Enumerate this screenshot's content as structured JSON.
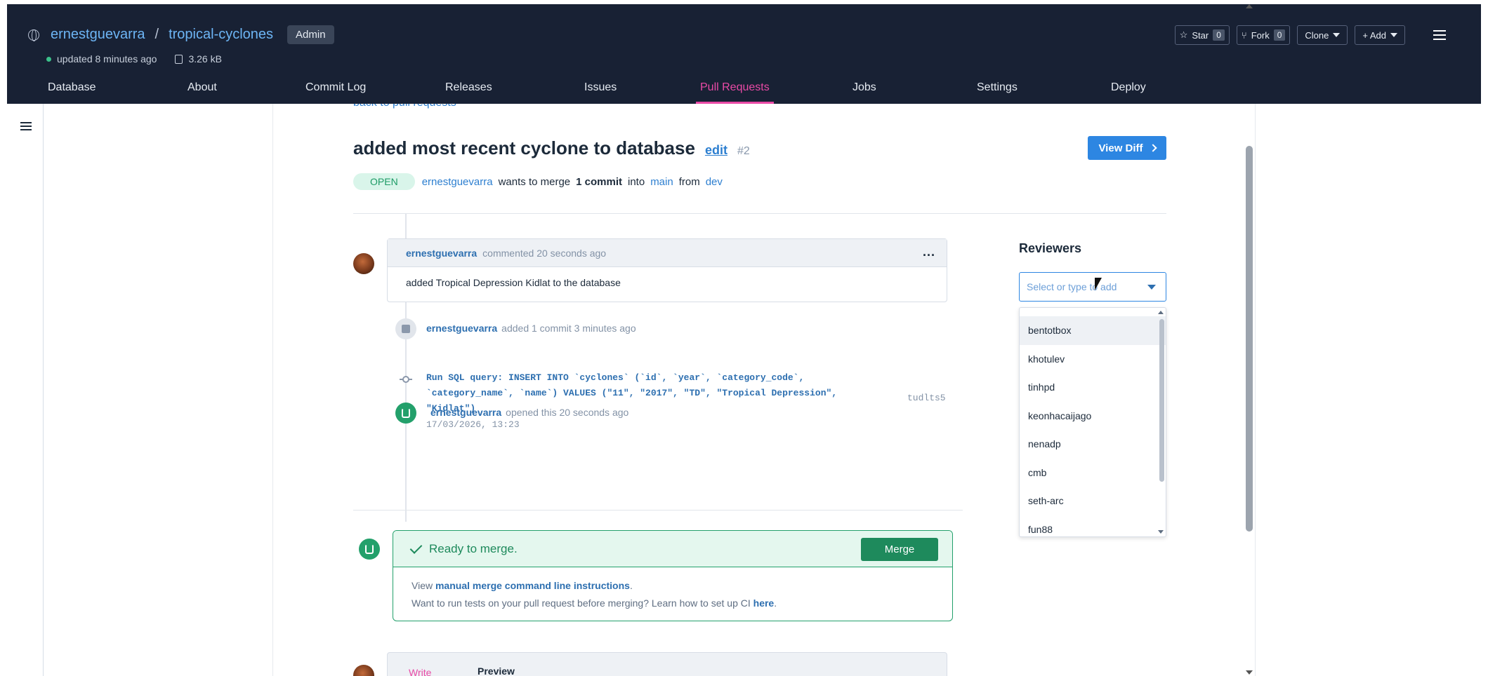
{
  "header": {
    "owner": "ernestguevarra",
    "separator": "/",
    "repo": "tropical-cyclones",
    "role_badge": "Admin",
    "updated": "updated 8 minutes ago",
    "size": "3.26 kB",
    "star_label": "Star",
    "star_count": "0",
    "fork_label": "Fork",
    "fork_count": "0",
    "clone_label": "Clone",
    "add_label": "+ Add"
  },
  "tabs": [
    "Database",
    "About",
    "Commit Log",
    "Releases",
    "Issues",
    "Pull Requests",
    "Jobs",
    "Settings",
    "Deploy"
  ],
  "active_tab": "Pull Requests",
  "pr": {
    "back_link": "back to pull requests",
    "title": "added most recent cyclone to database",
    "edit_label": "edit",
    "number": "#2",
    "view_diff": "View Diff",
    "status": "OPEN",
    "author": "ernestguevarra",
    "wants_to_merge": "wants to merge",
    "commit_count": "1 commit",
    "into": "into",
    "to_branch": "main",
    "from": "from",
    "from_branch": "dev"
  },
  "comment": {
    "author": "ernestguevarra",
    "action": "commented 20 seconds ago",
    "body": "added Tropical Depression Kidlat to the database",
    "more": "..."
  },
  "commit_event": {
    "author": "ernestguevarra",
    "action": "added 1 commit 3 minutes ago",
    "message": "Run SQL query: INSERT INTO `cyclones` (`id`, `year`, `category_code`, `category_name`, `name`) VALUES (\"11\", \"2017\", \"TD\", \"Tropical Depression\", \"Kidlat\")",
    "date": "17/03/2026, 13:23",
    "hash": "tudlts5"
  },
  "opened_event": {
    "author": "ernestguevarra",
    "action": "opened this 20 seconds ago"
  },
  "merge": {
    "status": "Ready to merge.",
    "button": "Merge",
    "view_prefix": "View",
    "instructions_link": "manual merge command line instructions",
    "period": ".",
    "ci_text": "Want to run tests on your pull request before merging? Learn how to set up CI",
    "ci_link": "here",
    "ci_end": "."
  },
  "editor": {
    "write_tab": "Write",
    "preview_tab": "Preview"
  },
  "reviewers": {
    "title": "Reviewers",
    "placeholder": "Select or type to add",
    "options": [
      "bentotbox",
      "khotulev",
      "tinhpd",
      "keonhacaijago",
      "nenadp",
      "cmb",
      "seth-arc",
      "fun88"
    ],
    "highlighted": "bentotbox"
  },
  "colors": {
    "header_bg": "#182134",
    "accent_pink": "#e94aa6",
    "link_blue": "#2d7fd0",
    "success_green": "#1e8a5c"
  }
}
